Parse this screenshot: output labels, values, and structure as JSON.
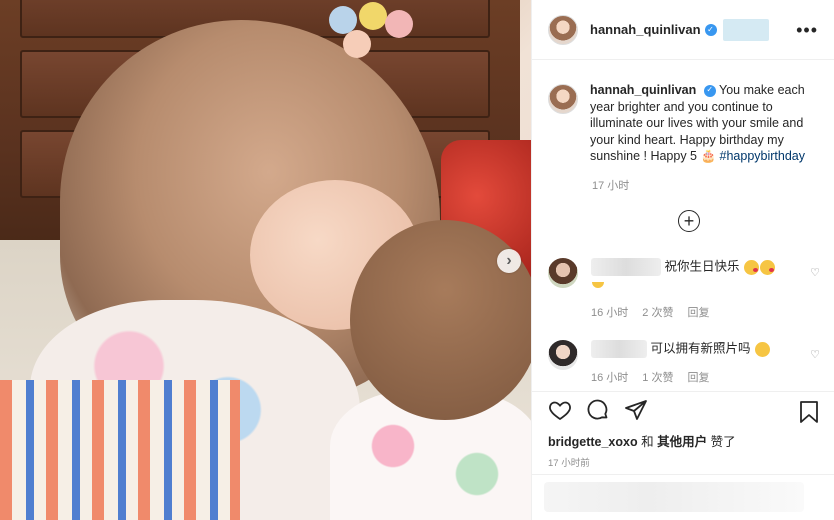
{
  "header": {
    "username": "hannah_quinlivan",
    "verified_glyph": "✓",
    "more_glyph": "•••"
  },
  "caption": {
    "username": "hannah_quinlivan",
    "text": "You make each year brighter and you continue to illuminate our lives with your smile and your kind heart. Happy birthday my sunshine ! Happy 5 🎂 ",
    "hashtag": "#happybirthday",
    "time": "17 小时"
  },
  "load_more_glyph": "+",
  "next_glyph": "›",
  "comments": [
    {
      "text": "祝你生日快乐",
      "time": "16 小时",
      "likes": "2 次赞",
      "reply": "回复"
    },
    {
      "text": "可以拥有新照片吗",
      "time": "16 小时",
      "likes": "1 次赞",
      "reply": "回复"
    }
  ],
  "heart_glyph": "♡",
  "likes": {
    "user": "bridgette_xoxo",
    "connector": "和",
    "others": "其他用户",
    "suffix": "赞了"
  },
  "post_time": "17 小时前",
  "colors": {
    "link": "#00376b",
    "verified": "#3897f0",
    "meta": "#8e8e8e"
  }
}
